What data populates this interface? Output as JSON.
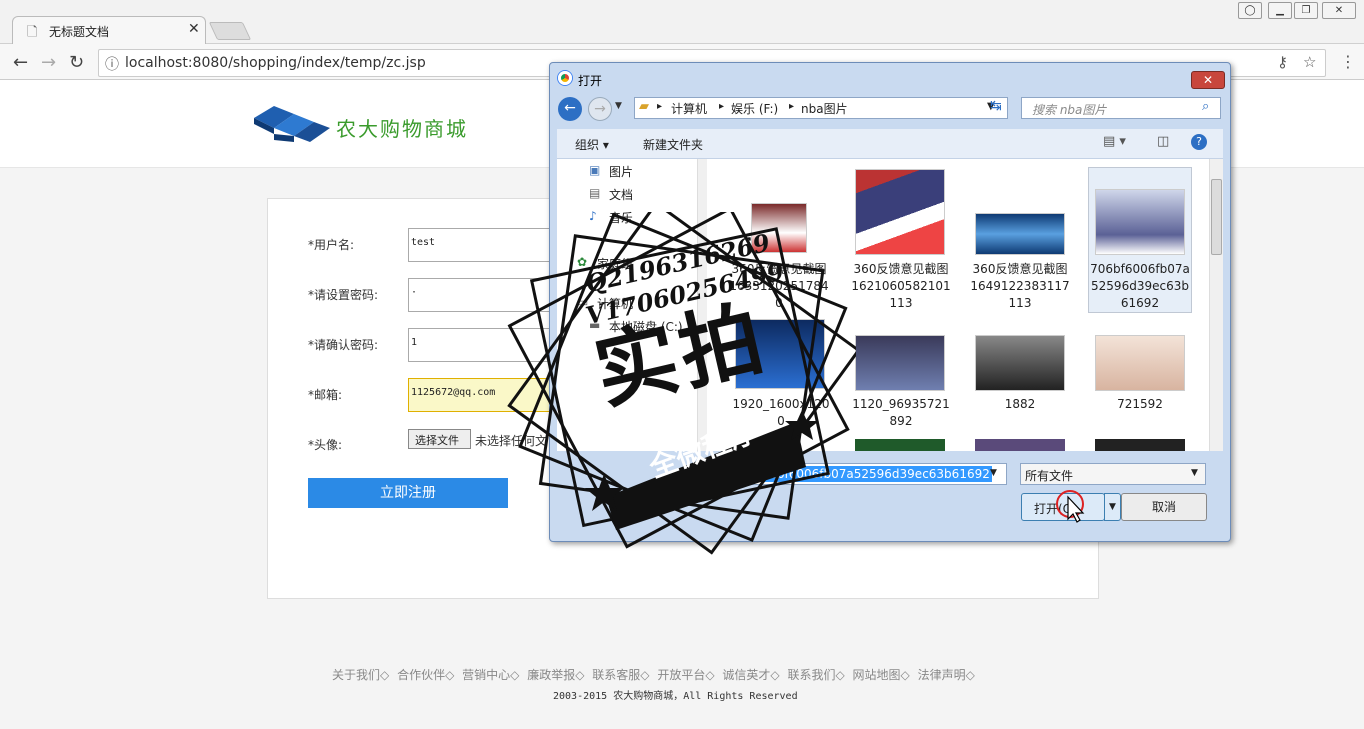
{
  "browser": {
    "tab_title": "无标题文档",
    "url": "localhost:8080/shopping/index/temp/zc.jsp"
  },
  "site": {
    "logo_text": "农大购物商城"
  },
  "form": {
    "username_label": "*用户名:",
    "username_value": "test",
    "password_label": "*请设置密码:",
    "password_value": "·",
    "confirm_label": "*请确认密码:",
    "confirm_value": "1",
    "email_label": "*邮箱:",
    "email_value": "1125672@qq.com",
    "avatar_label": "*头像:",
    "choose_file_label": "选择文件",
    "no_file_text": "未选择任何文",
    "submit_label": "立即注册"
  },
  "footer": {
    "links": [
      "关于我们◇",
      "合作伙伴◇",
      "营销中心◇",
      "廉政举报◇",
      "联系客服◇",
      "开放平台◇",
      "诚信英才◇",
      "联系我们◇",
      "网站地图◇",
      "法律声明◇"
    ],
    "copyright": "2003-2015 农大购物商城，All Rights Reserved"
  },
  "dialog": {
    "title": "打开",
    "breadcrumb": [
      "计算机",
      "娱乐 (F:)",
      "nba图片"
    ],
    "search_placeholder": "搜索 nba图片",
    "organize_label": "组织 ▾",
    "new_folder_label": "新建文件夹",
    "sidebar": [
      "图片",
      "文档",
      "音乐",
      "家庭组",
      "计算机",
      "本地磁盘 (C:)"
    ],
    "files": [
      {
        "name": "360反馈意见截图1633120251784 0"
      },
      {
        "name": "360反馈意见截图1621060582101 113"
      },
      {
        "name": "360反馈意见截图1649122383117 113"
      },
      {
        "name": "706bf6006fb07a52596d39ec63b61692"
      },
      {
        "name": "1920_1600x1200"
      },
      {
        "name": "1120_96935721892"
      },
      {
        "name": "1882"
      },
      {
        "name": "721592"
      }
    ],
    "filename_value": "706bf6006fb07a52596d39ec63b61692",
    "filetype_value": "所有文件",
    "open_label": "打开(O)",
    "cancel_label": "取消"
  },
  "watermark": {
    "line1": "Q2196316269",
    "line2": "V17060256499",
    "main": "实拍",
    "banner": "全微程序"
  },
  "colors": {
    "primary_button": "#2b8ae6",
    "logo_green": "#3a9b2c",
    "dialog_frame": "#c9daf0",
    "selection": "#3399ff"
  }
}
